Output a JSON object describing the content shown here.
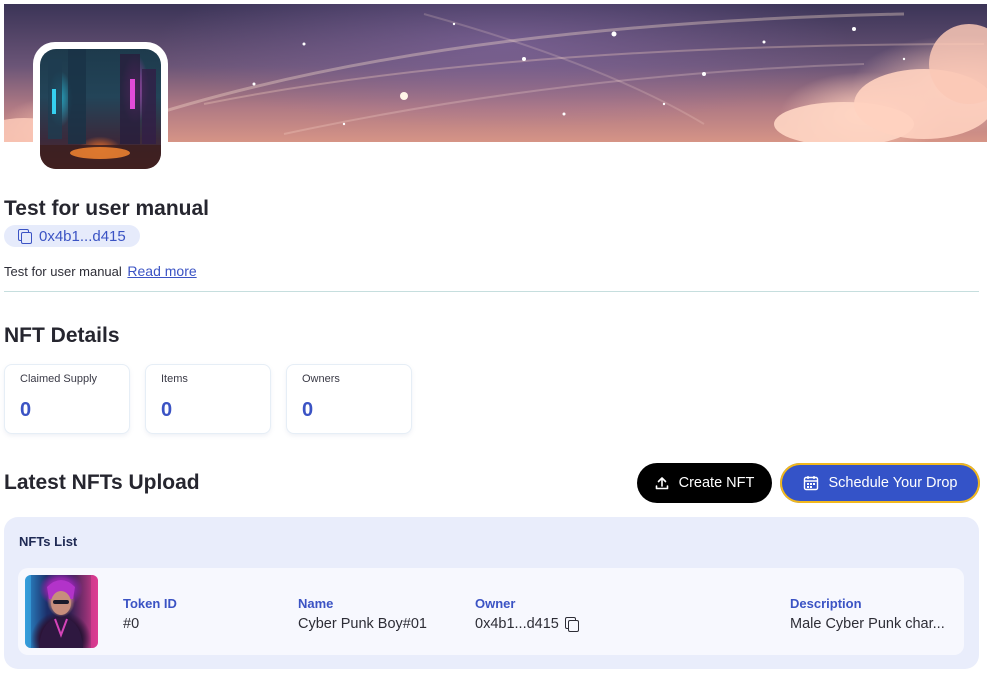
{
  "collection": {
    "title": "Test for user manual",
    "address": "0x4b1...d415",
    "description": "Test for user manual",
    "read_more": "Read more"
  },
  "details": {
    "heading": "NFT Details",
    "stats": [
      {
        "label": "Claimed Supply",
        "value": "0"
      },
      {
        "label": "Items",
        "value": "0"
      },
      {
        "label": "Owners",
        "value": "0"
      }
    ]
  },
  "uploads": {
    "heading": "Latest NFTs Upload",
    "create_label": "Create NFT",
    "schedule_label": "Schedule Your Drop",
    "list_title": "NFTs List",
    "columns": {
      "token_id": "Token ID",
      "name": "Name",
      "owner": "Owner",
      "description": "Description"
    },
    "rows": [
      {
        "token_id": "#0",
        "name": "Cyber Punk Boy#01",
        "owner": "0x4b1...d415",
        "description": "Male Cyber Punk char..."
      }
    ]
  },
  "icons": {
    "copy": "copy-icon",
    "upload": "upload-icon",
    "calendar": "calendar-icon"
  },
  "colors": {
    "accent": "#3b53c4",
    "schedule_button": "#3453c8",
    "create_button": "#000000",
    "highlight_ring": "#f2b81c",
    "list_panel": "#e9edfb"
  }
}
